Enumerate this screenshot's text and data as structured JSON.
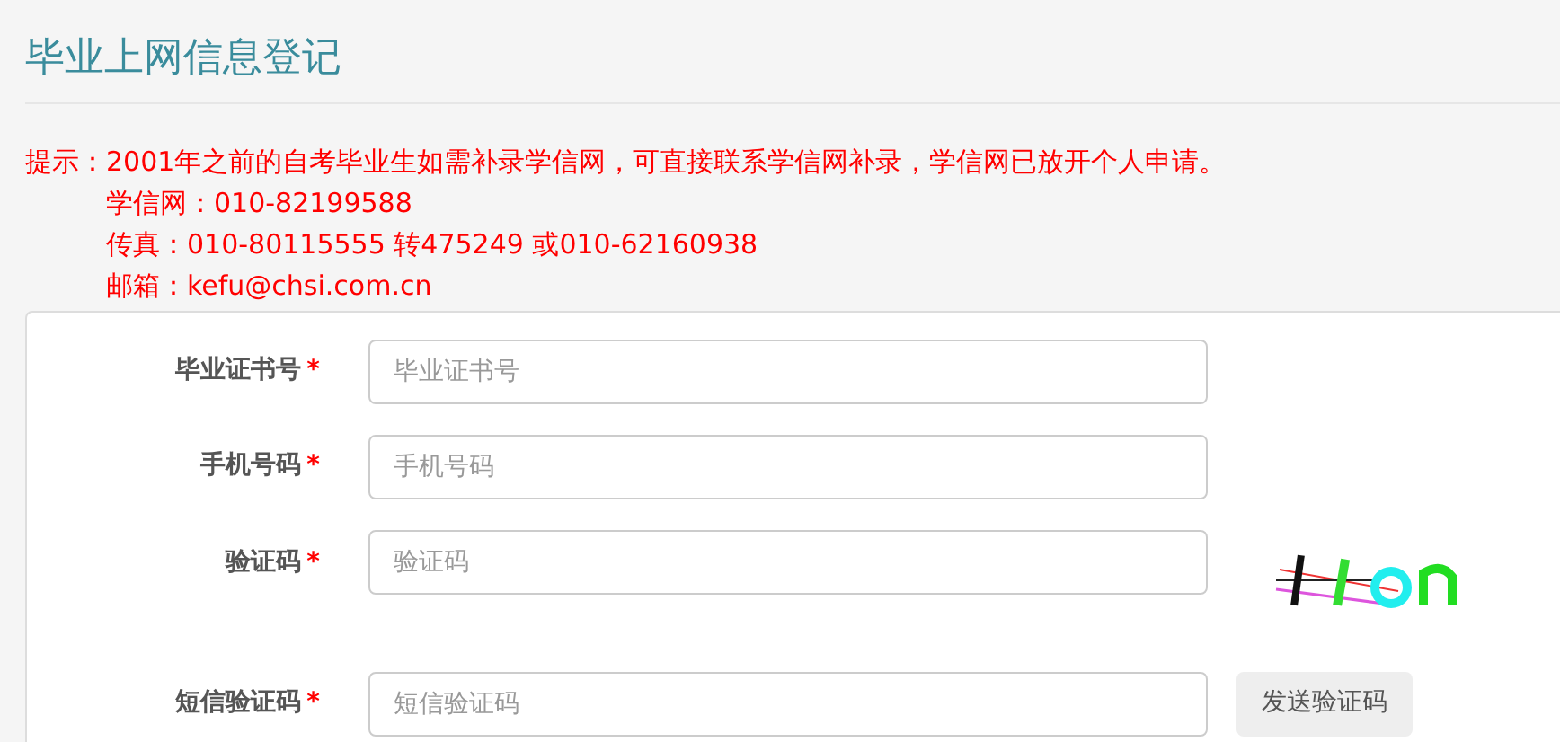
{
  "page_title": "毕业上网信息登记",
  "notice": {
    "prefix": "提示：",
    "lines": [
      "2001年之前的自考毕业生如需补录学信网，可直接联系学信网补录，学信网已放开个人申请。",
      "学信网：010-82199588",
      "传真：010-80115555 转475249 或010-62160938",
      "邮箱：kefu@chsi.com.cn"
    ]
  },
  "form": {
    "fields": [
      {
        "label": "毕业证书号",
        "required_mark": "*",
        "placeholder": "毕业证书号",
        "kind": "plain"
      },
      {
        "label": "手机号码",
        "required_mark": "*",
        "placeholder": "手机号码",
        "kind": "plain"
      },
      {
        "label": "验证码",
        "required_mark": "*",
        "placeholder": "验证码",
        "kind": "captcha"
      },
      {
        "label": "短信验证码",
        "required_mark": "*",
        "placeholder": "短信验证码",
        "kind": "sms",
        "button": "发送验证码"
      }
    ]
  }
}
